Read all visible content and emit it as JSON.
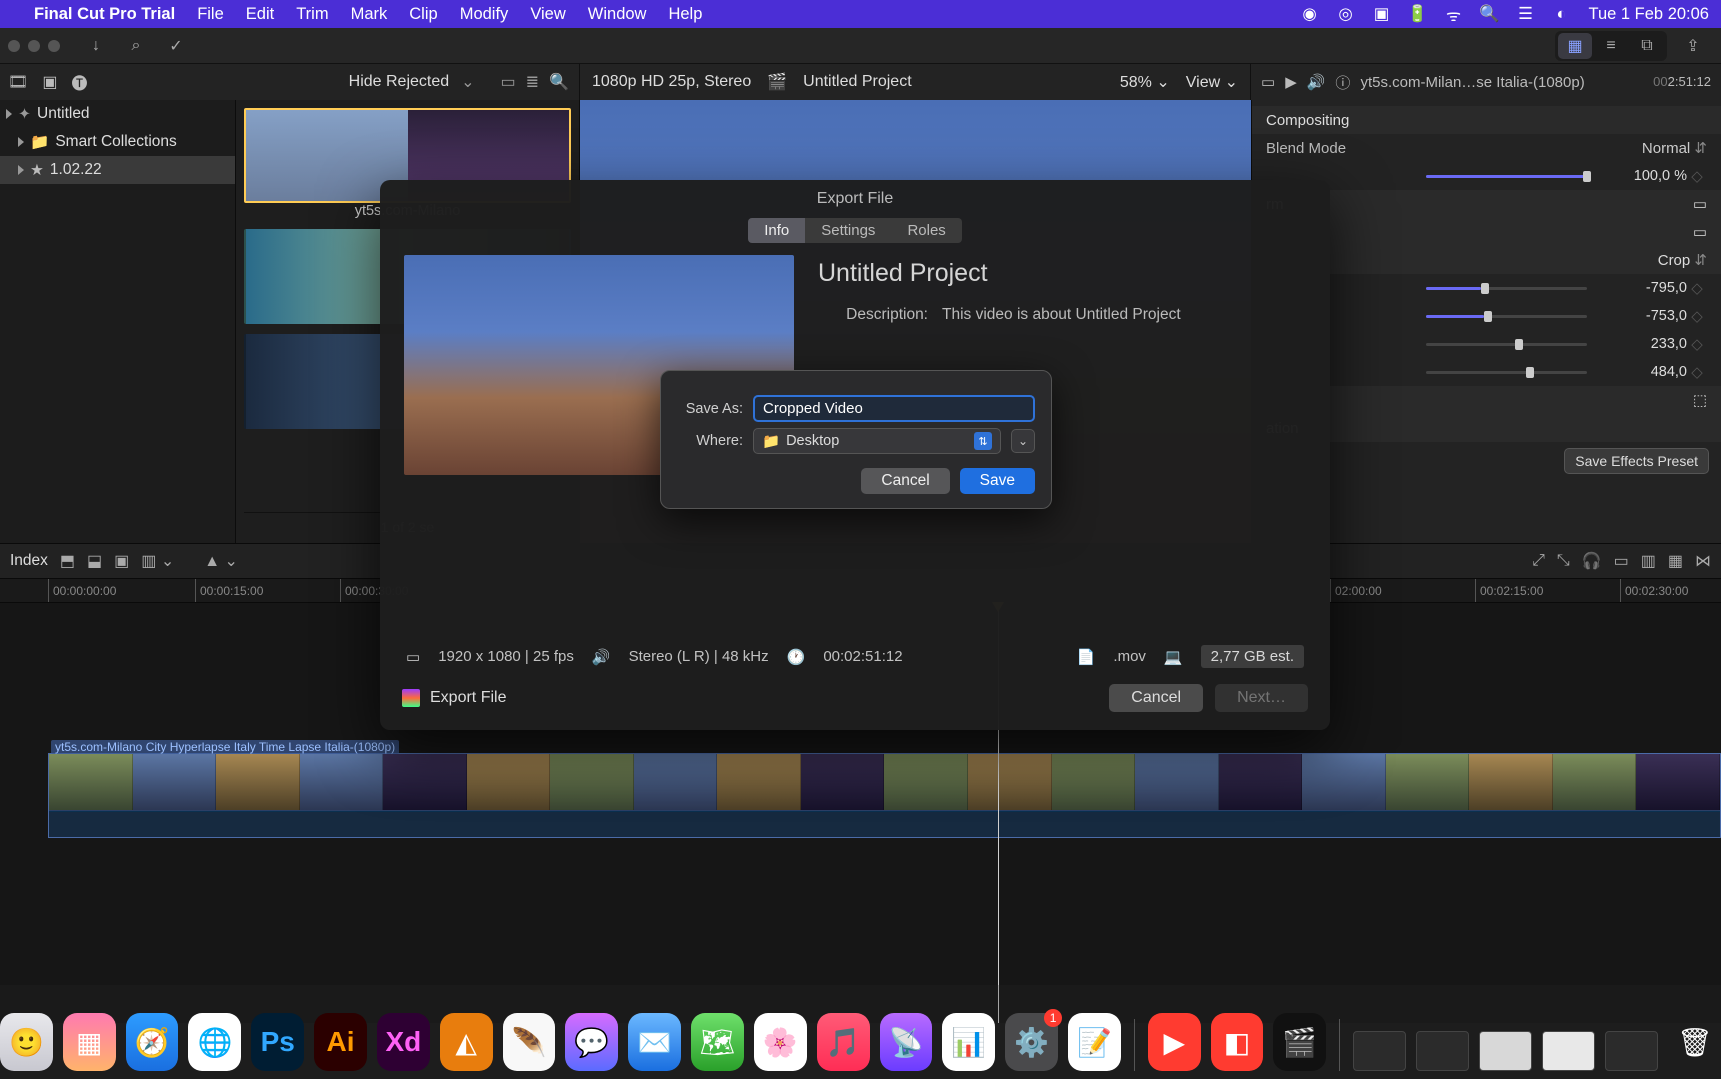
{
  "menubar": {
    "app": "Final Cut Pro Trial",
    "items": [
      "File",
      "Edit",
      "Trim",
      "Mark",
      "Clip",
      "Modify",
      "View",
      "Window",
      "Help"
    ],
    "clock": "Tue 1 Feb  20:06"
  },
  "library_header": {
    "hide": "Hide Rejected"
  },
  "viewer_header": {
    "format": "1080p HD 25p, Stereo",
    "project": "Untitled Project",
    "zoom": "58%",
    "view": "View"
  },
  "inspector_header": {
    "clip": "yt5s.com-Milan…se Italia-(1080p)",
    "tc_prefix": "00",
    "tc": "2:51:12"
  },
  "library": {
    "root": "Untitled",
    "smart": "Smart Collections",
    "event": "1.02.22"
  },
  "browser": {
    "clip_name": "yt5s.com-Milano",
    "footer": "1 of 2 se"
  },
  "inspector": {
    "sec_compositing": "Compositing",
    "blend_label": "Blend Mode",
    "blend_value": "Normal",
    "opacity_value": "100,0 %",
    "sec_transform_tail": "rm",
    "crop_label": "Crop",
    "vals": [
      "-795,0",
      "-753,0",
      "233,0",
      "484,0"
    ],
    "sec_stab_tail": "ation",
    "preset": "Save Effects Preset"
  },
  "timeline_toolbar": {
    "index": "Index"
  },
  "ruler": [
    "00:00:00:00",
    "00:00:15:00",
    "00:00:30:00",
    "02:00:00",
    "00:02:15:00",
    "00:02:30:00"
  ],
  "timeline_clip": {
    "name": "yt5s.com-Milano City Hyperlapse Italy Time Lapse Italia-(1080p)"
  },
  "export": {
    "title": "Export File",
    "tabs": [
      "Info",
      "Settings",
      "Roles"
    ],
    "project": "Untitled Project",
    "desc_k": "Description:",
    "desc_v": "This video is about Untitled Project",
    "res": "1920 x 1080",
    "fps": "25 fps",
    "audio": "Stereo (L R)",
    "khz": "48 kHz",
    "dur": "00:02:51:12",
    "ext": ".mov",
    "size": "2,77 GB est.",
    "label": "Export File",
    "cancel": "Cancel",
    "next": "Next…"
  },
  "save_sheet": {
    "save_as": "Save As:",
    "filename": "Cropped Video",
    "where": "Where:",
    "location": "Desktop",
    "cancel": "Cancel",
    "save": "Save"
  },
  "dock": {
    "badge": "1"
  }
}
